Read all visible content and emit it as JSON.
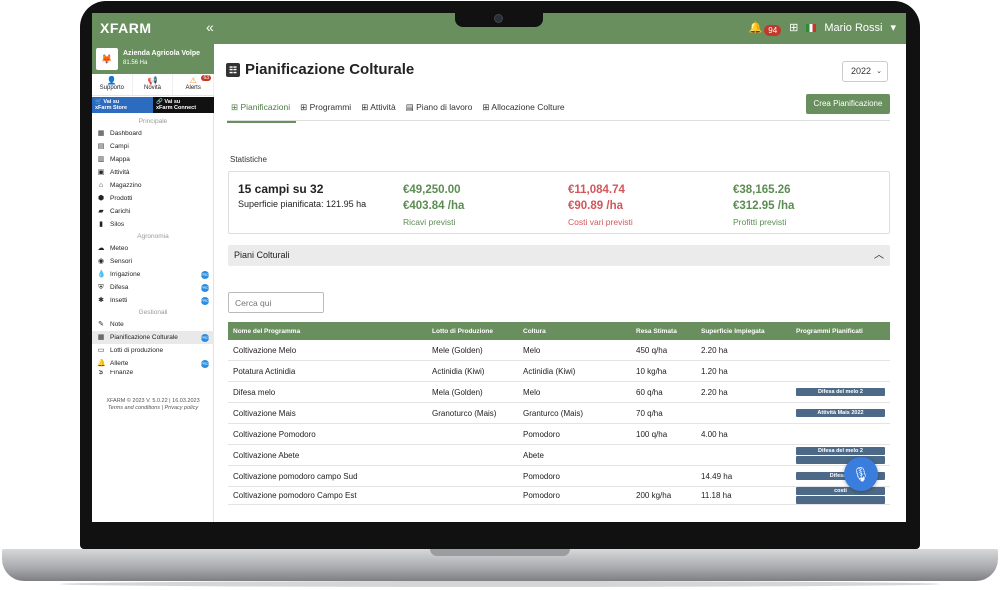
{
  "topbar": {
    "logo": "XFARM",
    "collapse_icon": "double-chevron-left",
    "notifications_count": "94",
    "user_name": "Mario Rossi",
    "user_caret": "▾"
  },
  "farm": {
    "name": "Azienda Agricola Volpe",
    "area": "81.56 Ha"
  },
  "quick_links": [
    {
      "label": "Supporto",
      "icon": "user-icon"
    },
    {
      "label": "Novità",
      "icon": "megaphone-icon"
    },
    {
      "label": "Alerts",
      "icon": "warning-icon",
      "badge": "63"
    }
  ],
  "stores": [
    {
      "line1": "Vai su",
      "line2": "xFarm Store"
    },
    {
      "line1": "Vai su",
      "line2": "xFarm Connect"
    }
  ],
  "sidebar": {
    "sections": [
      {
        "title": "Principale",
        "items": [
          "Dashboard",
          "Campi",
          "Mappa",
          "Attività",
          "Magazzino",
          "Prodotti",
          "Carichi",
          "Silos"
        ]
      },
      {
        "title": "Agronomia",
        "items": [
          "Meteo",
          "Sensori",
          "Irrigazione",
          "Difesa",
          "Insetti"
        ]
      },
      {
        "title": "Gestionali",
        "items": [
          "Note",
          "Pianificazione Colturale",
          "Lotti di produzione",
          "Allerte",
          "Finanze"
        ]
      }
    ],
    "pro_label": "PRO",
    "footer_line1": "XFARM © 2023 V. 5.0.22 | 16.03.2023",
    "footer_line2": "Terms and conditions | Privacy policy"
  },
  "page": {
    "title": "Pianificazione Colturale",
    "year": "2022",
    "tabs": [
      "Pianificazioni",
      "Programmi",
      "Attività",
      "Piano di lavoro",
      "Allocazione Colture"
    ],
    "create_button": "Crea Pianificazione"
  },
  "stats": {
    "label": "Statistiche",
    "count": "15 campi su 32",
    "surface": "Superficie pianificata: 121.95 ha",
    "revenue_total": "€49,250.00",
    "revenue_per_ha": "€403.84 /ha",
    "revenue_label": "Ricavi previsti",
    "costs_total": "€11,084.74",
    "costs_per_ha": "€90.89 /ha",
    "costs_label": "Costi vari previsti",
    "profit_total": "€38,165.26",
    "profit_per_ha": "€312.95 /ha",
    "profit_label": "Profitti previsti"
  },
  "piani": {
    "label": "Piani Colturali",
    "search_placeholder": "Cerca qui"
  },
  "table": {
    "headers": [
      "Nome del Programma",
      "Lotto di Produzione",
      "Coltura",
      "Resa Stimata",
      "Superficie Impiegata",
      "Programmi Pianificati"
    ],
    "rows": [
      {
        "nome": "Coltivazione Melo",
        "lotto": "Mele (Golden)",
        "coltura": "Melo",
        "resa": "450 q/ha",
        "superficie": "2.20 ha",
        "programmi": []
      },
      {
        "nome": "Potatura Actinidia",
        "lotto": "Actinidia (Kiwi)",
        "coltura": "Actinidia (Kiwi)",
        "resa": "10 kg/ha",
        "superficie": "1.20 ha",
        "programmi": []
      },
      {
        "nome": "Difesa melo",
        "lotto": "Mela (Golden)",
        "coltura": "Melo",
        "resa": "60 q/ha",
        "superficie": "2.20 ha",
        "programmi": [
          "Difesa del melo 2"
        ]
      },
      {
        "nome": "Coltivazione Mais",
        "lotto": "Granoturco (Mais)",
        "coltura": "Granturco (Mais)",
        "resa": "70 q/ha",
        "superficie": "",
        "programmi": [
          "Attività Mais 2022"
        ]
      },
      {
        "nome": "Coltivazione Pomodoro",
        "lotto": "",
        "coltura": "Pomodoro",
        "resa": "100 q/ha",
        "superficie": "4.00 ha",
        "programmi": []
      },
      {
        "nome": "Coltivazione Abete",
        "lotto": "",
        "coltura": "Abete",
        "resa": "",
        "superficie": "",
        "programmi": [
          "Difesa del melo 2",
          ""
        ]
      },
      {
        "nome": "Coltivazione pomodoro campo Sud",
        "lotto": "",
        "coltura": "Pomodoro",
        "resa": "",
        "superficie": "14.49 ha",
        "programmi": [
          "Difesa d"
        ]
      },
      {
        "nome": "Coltivazione pomodoro Campo Est",
        "lotto": "",
        "coltura": "Pomodoro",
        "resa": "200 kg/ha",
        "superficie": "11.18 ha",
        "programmi": [
          "costi",
          ""
        ]
      }
    ]
  },
  "colors": {
    "brand": "#6a8f5e",
    "accent_blue": "#3b7ddd",
    "profit_green": "#5b8d52",
    "cost_red": "#d2565a"
  }
}
